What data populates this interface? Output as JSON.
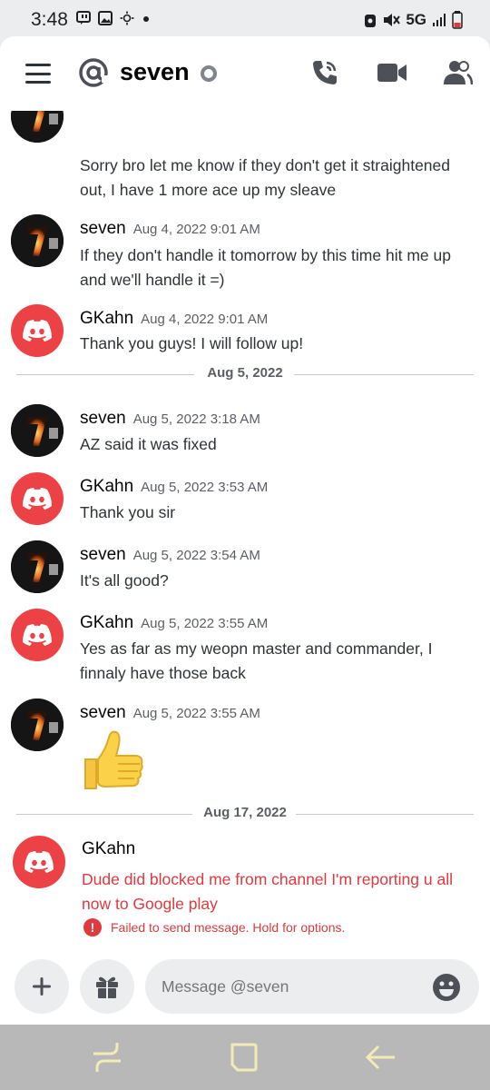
{
  "status": {
    "time": "3:48",
    "network": "5G"
  },
  "header": {
    "channel_name": "seven"
  },
  "messages": [
    {
      "text": "Sorry bro let me know if they don't get it straightened out, I have 1 more ace up my sleave"
    },
    {
      "author": "seven",
      "time": "Aug 4, 2022 9:01 AM",
      "text": "If they don't handle it tomorrow by this time hit me up and we'll handle it =)"
    },
    {
      "author": "GKahn",
      "time": "Aug 4, 2022 9:01 AM",
      "text": "Thank you guys! I will follow up!"
    },
    {
      "author": "seven",
      "time": "Aug 5, 2022 3:18 AM",
      "text": "AZ said it was fixed"
    },
    {
      "author": "GKahn",
      "time": "Aug 5, 2022 3:53 AM",
      "text": "Thank you sir"
    },
    {
      "author": "seven",
      "time": "Aug 5, 2022 3:54 AM",
      "text": "It's all good?"
    },
    {
      "author": "GKahn",
      "time": "Aug 5, 2022 3:55 AM",
      "text": "Yes as far as my weopn master and commander, I finnaly have those back"
    },
    {
      "author": "seven",
      "time": "Aug 5, 2022 3:55 AM",
      "text": "👍"
    },
    {
      "author": "GKahn",
      "text": "Dude did blocked me from channel I'm reporting u all now to Google play",
      "error": "Failed to send message. Hold for options."
    }
  ],
  "dividers": [
    "Aug 5, 2022",
    "Aug 17, 2022"
  ],
  "composer": {
    "placeholder": "Message @seven"
  },
  "colors": {
    "accent_red": "#ed4245",
    "error_red": "#e0393e",
    "background": "#ffffff"
  },
  "icons": [
    "hamburger-icon",
    "at-icon",
    "call-icon",
    "video-icon",
    "members-icon",
    "plus-icon",
    "gift-icon",
    "emoji-icon",
    "recent-apps-icon",
    "home-icon",
    "back-icon"
  ]
}
